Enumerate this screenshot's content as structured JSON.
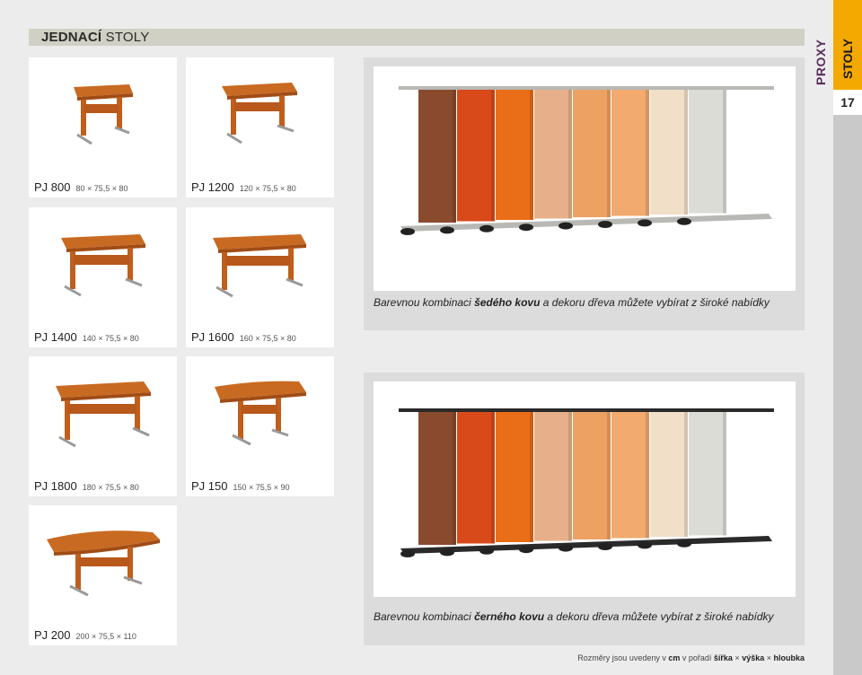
{
  "header": {
    "title_bold": "JEDNACÍ",
    "title_rest": "STOLY"
  },
  "side": {
    "category": "STOLY",
    "brand": "PROXY",
    "page": "17"
  },
  "products": [
    {
      "code": "PJ 800",
      "dims": "80 × 75,5 × 80"
    },
    {
      "code": "PJ 1200",
      "dims": "120 × 75,5 × 80"
    },
    {
      "code": "PJ 1400",
      "dims": "140 × 75,5 × 80"
    },
    {
      "code": "PJ 1600",
      "dims": "160 × 75,5 × 80"
    },
    {
      "code": "PJ 1800",
      "dims": "180 × 75,5 × 80"
    },
    {
      "code": "PJ 150",
      "dims": "150 × 75,5 × 90"
    },
    {
      "code": "PJ 200",
      "dims": "200 × 75,5 × 110"
    }
  ],
  "panels": [
    {
      "caption_pre": "Barevnou kombinaci ",
      "caption_bold": "šedého kovu",
      "caption_post": " a dekoru dřeva můžete vybírat z široké nabídky",
      "frame_color": "#b8b8b4"
    },
    {
      "caption_pre": "Barevnou kombinaci ",
      "caption_bold": "černého kovu",
      "caption_post": " a dekoru dřeva můžete vybírat z široké nabídky",
      "frame_color": "#2a2a2a"
    }
  ],
  "decor_colors": [
    "#8a4a2e",
    "#d94a1a",
    "#ea6d18",
    "#e7b08a",
    "#eda162",
    "#f2aa6e",
    "#f1dfc8",
    "#dcdcd6"
  ],
  "footnote": {
    "pre": "Rozměry jsou uvedeny v ",
    "unit": "cm",
    "mid": " v pořadí ",
    "w": "šířka",
    "x1": " × ",
    "h": "výška",
    "x2": " × ",
    "d": "hloubka"
  }
}
